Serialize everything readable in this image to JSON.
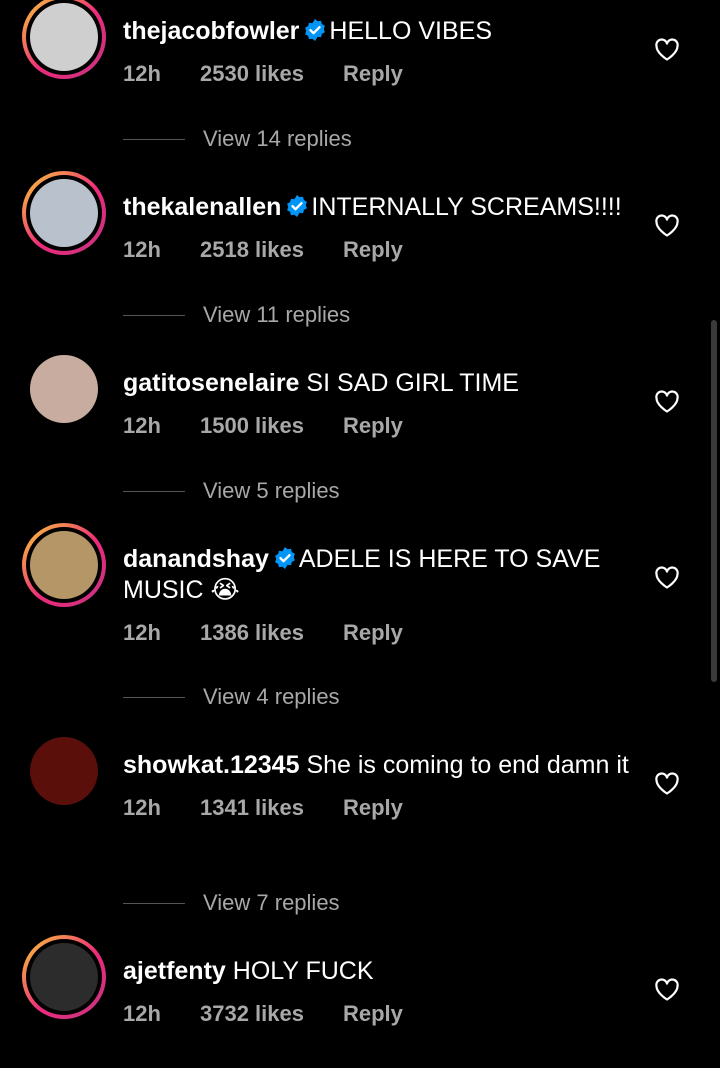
{
  "comments": [
    {
      "username": "thejacobfowler",
      "verified": true,
      "text": "HELLO VIBES",
      "time": "12h",
      "likes": "2530 likes",
      "reply": "Reply",
      "replies_label": "View 14 replies",
      "ring": true,
      "avatar_color": "#cfcfcf"
    },
    {
      "username": "thekalenallen",
      "verified": true,
      "text": "INTERNALLY SCREAMS!!!!",
      "time": "12h",
      "likes": "2518 likes",
      "reply": "Reply",
      "replies_label": "View 11 replies",
      "ring": true,
      "avatar_color": "#b9c2cc"
    },
    {
      "username": "gatitosenelaire",
      "verified": false,
      "text": "SI SAD GIRL TIME",
      "time": "12h",
      "likes": "1500 likes",
      "reply": "Reply",
      "replies_label": "View 5 replies",
      "ring": false,
      "avatar_color": "#c9aca0"
    },
    {
      "username": "danandshay",
      "verified": true,
      "text": "ADELE IS HERE TO SAVE MUSIC 😭",
      "time": "12h",
      "likes": "1386 likes",
      "reply": "Reply",
      "replies_label": "View 4 replies",
      "ring": true,
      "avatar_color": "#b59666"
    },
    {
      "username": "showkat.12345",
      "verified": false,
      "text": "She is coming to end damn it",
      "time": "12h",
      "likes": "1341 likes",
      "reply": "Reply",
      "replies_label": "View 7 replies",
      "ring": false,
      "avatar_color": "#5a0f0a"
    },
    {
      "username": "ajetfenty",
      "verified": false,
      "text": "HOLY FUCK",
      "time": "12h",
      "likes": "3732 likes",
      "reply": "Reply",
      "replies_label": "",
      "ring": true,
      "avatar_color": "#2c2c2c"
    }
  ],
  "colors": {
    "verified": "#0095f6",
    "muted": "#a8a8a8",
    "background": "#000000"
  }
}
